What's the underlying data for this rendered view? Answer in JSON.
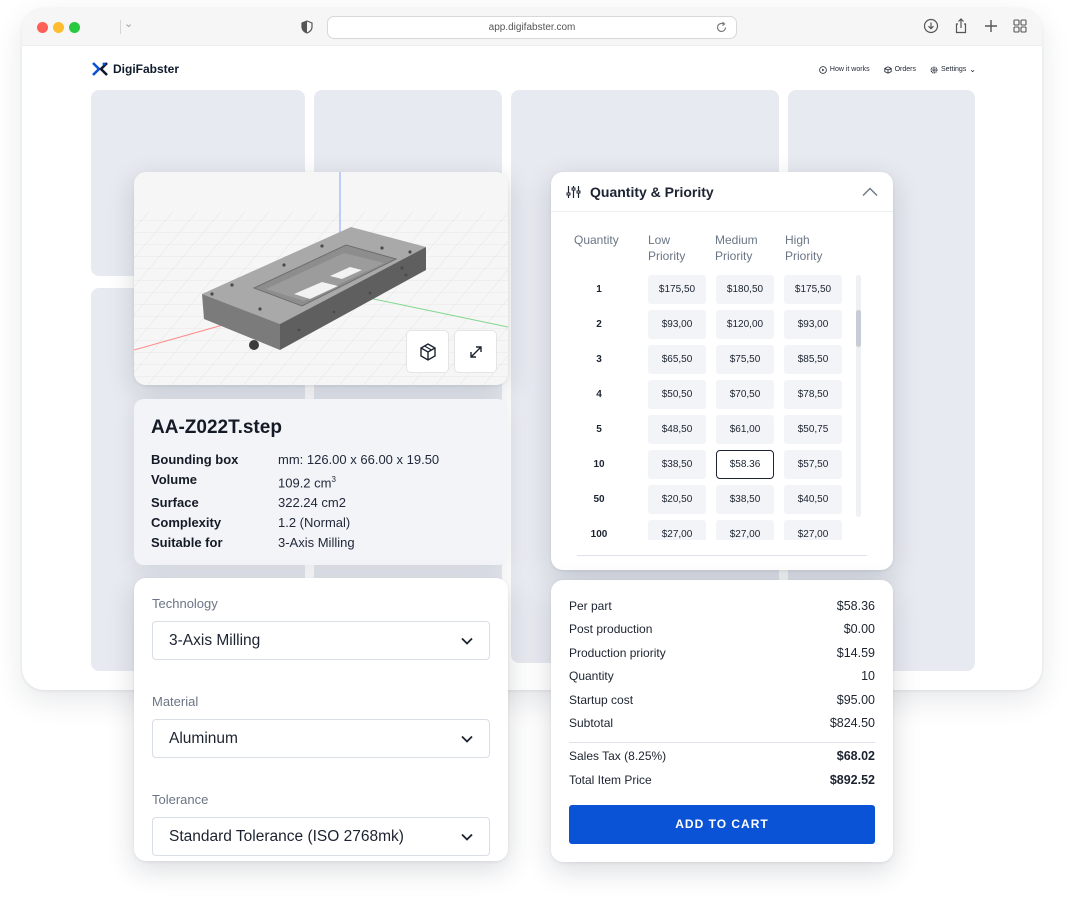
{
  "browser": {
    "url": "app.digifabster.com"
  },
  "header": {
    "logo_text": "DigiFabster",
    "nav": [
      {
        "label": "How it works",
        "icon": "play-circle-icon"
      },
      {
        "label": "Orders",
        "icon": "box-icon"
      },
      {
        "label": "Settings",
        "icon": "gear-icon"
      }
    ]
  },
  "model": {
    "filename": "AA-Z022T.step",
    "details": [
      {
        "key": "Bounding box",
        "value": "mm: 126.00 x 66.00 x 19.50"
      },
      {
        "key": "Volume",
        "value": "109.2 cm"
      },
      {
        "key": "Surface",
        "value": "322.24 cm2"
      },
      {
        "key": "Complexity",
        "value": "1.2 (Normal)"
      },
      {
        "key": "Suitable for",
        "value": "3-Axis Milling"
      }
    ],
    "volume_superscript": "3"
  },
  "config": {
    "technology_label": "Technology",
    "technology_value": "3-Axis Milling",
    "material_label": "Material",
    "material_value": "Aluminum",
    "tolerance_label": "Tolerance",
    "tolerance_value": "Standard Tolerance (ISO 2768mk)"
  },
  "quantity_priority": {
    "title": "Quantity & Priority",
    "columns": [
      "Quantity",
      "Low\nPriority",
      "Medium\nPriority",
      "High\nPriority"
    ],
    "selected": {
      "row": 5,
      "col": 1
    },
    "rows": [
      {
        "qty": "1",
        "prices": [
          "$175,50",
          "$180,50",
          "$175,50"
        ]
      },
      {
        "qty": "2",
        "prices": [
          "$93,00",
          "$120,00",
          "$93,00"
        ]
      },
      {
        "qty": "3",
        "prices": [
          "$65,50",
          "$75,50",
          "$85,50"
        ]
      },
      {
        "qty": "4",
        "prices": [
          "$50,50",
          "$70,50",
          "$78,50"
        ]
      },
      {
        "qty": "5",
        "prices": [
          "$48,50",
          "$61,00",
          "$50,75"
        ]
      },
      {
        "qty": "10",
        "prices": [
          "$38,50",
          "$58.36",
          "$57,50"
        ]
      },
      {
        "qty": "50",
        "prices": [
          "$20,50",
          "$38,50",
          "$40,50"
        ]
      },
      {
        "qty": "100",
        "prices": [
          "$27,00",
          "$27,00",
          "$27,00"
        ]
      }
    ]
  },
  "summary": {
    "rows": [
      {
        "label": "Per part",
        "value": "$58.36"
      },
      {
        "label": "Post production",
        "value": "$0.00"
      },
      {
        "label": "Production priority",
        "value": "$14.59"
      },
      {
        "label": "Quantity",
        "value": "10"
      },
      {
        "label": "Startup cost",
        "value": "$95.00"
      },
      {
        "label": "Subtotal",
        "value": "$824.50"
      }
    ],
    "totals": [
      {
        "label": "Sales Tax (8.25%)",
        "value": "$68.02"
      },
      {
        "label": "Total Item Price",
        "value": "$892.52"
      }
    ],
    "cta": "ADD TO CART"
  },
  "colors": {
    "brand": "#0a53d6",
    "background_card": "#e7eaf0",
    "panel": "#f2f4f8"
  }
}
